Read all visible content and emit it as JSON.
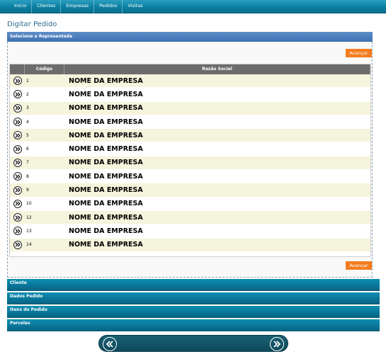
{
  "nav": {
    "items": [
      "Início",
      "Clientes",
      "Empresas",
      "Pedidos",
      "Visitas"
    ]
  },
  "page": {
    "title": "Digitar Pedido"
  },
  "section": {
    "title": "Selecione a Representada"
  },
  "actions": {
    "advance_label": "Avançar"
  },
  "table": {
    "headers": {
      "code": "Código",
      "name": "Razão Social"
    },
    "rows": [
      {
        "code": "1",
        "name": "NOME DA EMPRESA"
      },
      {
        "code": "2",
        "name": "NOME DA EMPRESA"
      },
      {
        "code": "3",
        "name": "NOME DA EMPRESA"
      },
      {
        "code": "4",
        "name": "NOME DA EMPRESA"
      },
      {
        "code": "5",
        "name": "NOME DA EMPRESA"
      },
      {
        "code": "6",
        "name": "NOME DA EMPRESA"
      },
      {
        "code": "7",
        "name": "NOME DA EMPRESA"
      },
      {
        "code": "8",
        "name": "NOME DA EMPRESA"
      },
      {
        "code": "9",
        "name": "NOME DA EMPRESA"
      },
      {
        "code": "10",
        "name": "NOME DA EMPRESA"
      },
      {
        "code": "12",
        "name": "NOME DA EMPRESA"
      },
      {
        "code": "13",
        "name": "NOME DA EMPRESA"
      },
      {
        "code": "14",
        "name": "NOME DA EMPRESA"
      }
    ]
  },
  "accordion": {
    "items": [
      "Cliente",
      "Dados Pedido",
      "Itens do Pedido",
      "Parcelas"
    ]
  },
  "icons": {
    "row_select": "double-chevron-right-icon",
    "pager_prev": "double-chevron-left-icon",
    "pager_next": "double-chevron-right-icon"
  },
  "colors": {
    "nav_bg": "#0b7ea2",
    "section_bar": "#4a7bbd",
    "advance_button": "#f57c1f",
    "row_alt": "#f5f4dc",
    "table_header": "#6c6c6c",
    "pager_bg": "#155566"
  }
}
